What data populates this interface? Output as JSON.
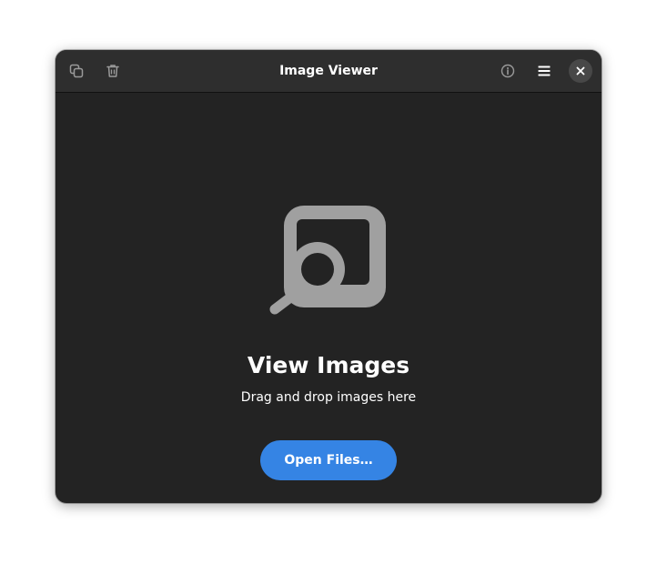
{
  "window": {
    "title": "Image Viewer"
  },
  "headerbar": {
    "buttons": [
      {
        "icon": "copy-icon"
      },
      {
        "icon": "trash-icon"
      },
      {
        "icon": "info-icon"
      },
      {
        "icon": "hamburger-menu-icon"
      },
      {
        "icon": "close-icon"
      }
    ]
  },
  "status_page": {
    "icon": "image-viewer-icon",
    "title": "View Images",
    "description": "Drag and drop images here",
    "button_label": "Open Files…"
  },
  "colors": {
    "window_bg": "#232323",
    "headerbar_bg": "#2e2e2e",
    "accent": "#3584e4",
    "icon_gray": "#a0a0a0"
  }
}
